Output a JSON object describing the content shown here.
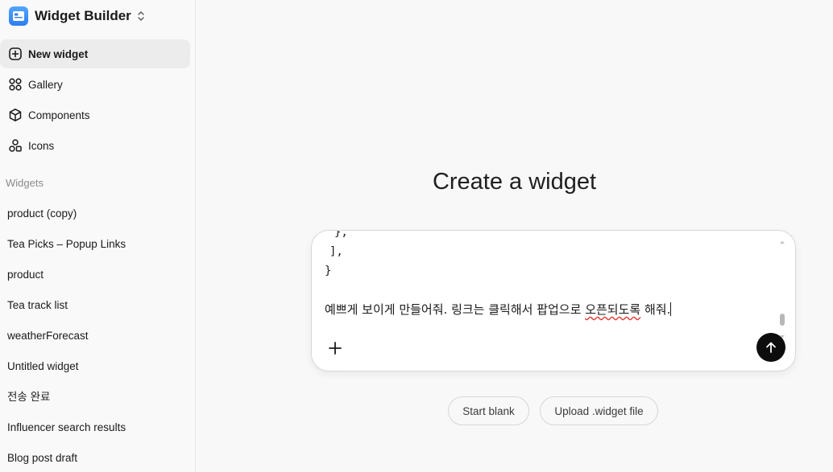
{
  "app": {
    "title": "Widget Builder",
    "logo_icon": "widget-builder-logo-icon",
    "switcher_icon": "chevron-up-down-icon"
  },
  "sidebar": {
    "nav": [
      {
        "label": "New widget",
        "icon": "plus-square-icon",
        "active": true
      },
      {
        "label": "Gallery",
        "icon": "grid-circles-icon",
        "active": false
      },
      {
        "label": "Components",
        "icon": "cube-icon",
        "active": false
      },
      {
        "label": "Icons",
        "icon": "shapes-icon",
        "active": false
      }
    ],
    "section_label": "Widgets",
    "widgets": [
      "product (copy)",
      "Tea Picks – Popup Links",
      "product",
      "Tea track list",
      "weatherForecast",
      "Untitled widget",
      "전송 완료",
      "Influencer search results",
      "Blog post draft"
    ]
  },
  "main": {
    "title": "Create a widget",
    "composer": {
      "code_lines": [
        "},",
        "],",
        "}"
      ],
      "prompt_before": "예쁘게 보이게 만들어줘. 링크는 클릭해서 팝업으로 ",
      "prompt_misspelled": "오픈되도록",
      "prompt_after": " 해줘.",
      "add_icon": "plus-icon",
      "send_icon": "arrow-up-icon"
    },
    "actions": {
      "start_blank": "Start blank",
      "upload": "Upload .widget file"
    }
  },
  "colors": {
    "accent_logo": "#2b7ef0",
    "send_button": "#0d0d0d",
    "active_nav_bg": "#ececec",
    "spellcheck": "#e0443b"
  }
}
